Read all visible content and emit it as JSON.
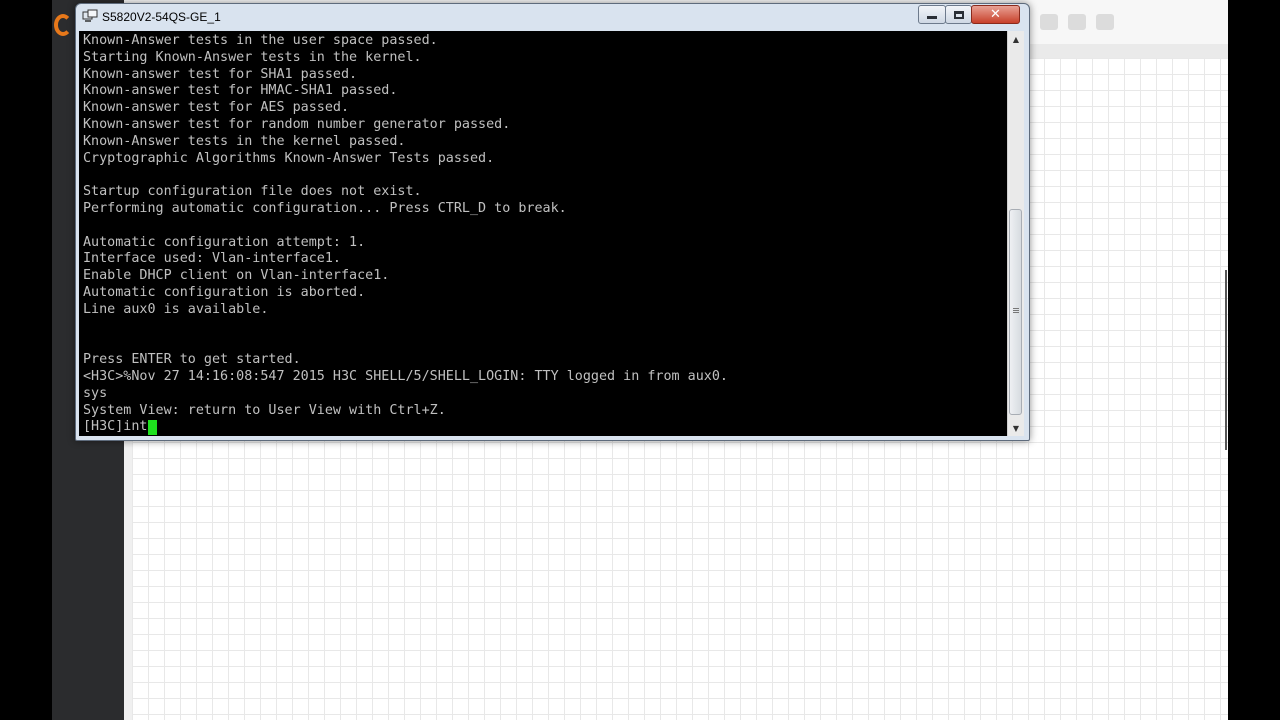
{
  "window": {
    "title": "S5820V2-54QS-GE_1",
    "close_glyph": "✕"
  },
  "terminal": {
    "lines": [
      "Known-Answer tests in the user space passed.",
      "Starting Known-Answer tests in the kernel.",
      "Known-answer test for SHA1 passed.",
      "Known-answer test for HMAC-SHA1 passed.",
      "Known-answer test for AES passed.",
      "Known-answer test for random number generator passed.",
      "Known-Answer tests in the kernel passed.",
      "Cryptographic Algorithms Known-Answer Tests passed.",
      "",
      "Startup configuration file does not exist.",
      "Performing automatic configuration... Press CTRL_D to break.",
      "",
      "Automatic configuration attempt: 1.",
      "Interface used: Vlan-interface1.",
      "Enable DHCP client on Vlan-interface1.",
      "Automatic configuration is aborted.",
      "Line aux0 is available.",
      "",
      "",
      "Press ENTER to get started.",
      "<H3C>%Nov 27 14:16:08:547 2015 H3C SHELL/5/SHELL_LOGIN: TTY logged in from aux0.",
      "sys",
      "System View: return to User View with Ctrl+Z."
    ],
    "prompt_input": "[H3C]int",
    "text_color": "#c0c0c0",
    "cursor_color": "#1ee01e"
  },
  "scrollbar": {
    "up_glyph": "▲",
    "down_glyph": "▼"
  },
  "background": {
    "accent_logo_color": "#e7781a"
  }
}
